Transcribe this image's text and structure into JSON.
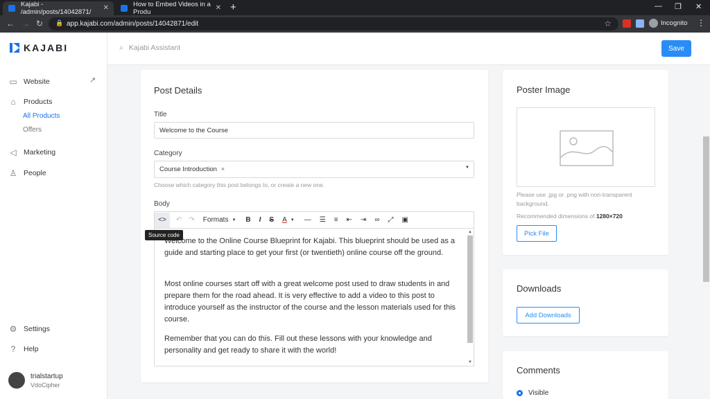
{
  "browser": {
    "tabs": [
      {
        "title": "Kajabi - /admin/posts/14042871/"
      },
      {
        "title": "How to Embed Videos in a Produ"
      }
    ],
    "url": "app.kajabi.com/admin/posts/14042871/edit",
    "profile": "Incognito"
  },
  "app": {
    "logo": "KAJABI",
    "search_placeholder": "Kajabi Assistant",
    "save_label": "Save"
  },
  "sidebar": {
    "website": "Website",
    "products": "Products",
    "all_products": "All Products",
    "offers": "Offers",
    "marketing": "Marketing",
    "people": "People",
    "settings": "Settings",
    "help": "Help",
    "user_name": "trialstartup",
    "user_org": "VdoCipher"
  },
  "post": {
    "heading": "Post Details",
    "title_label": "Title",
    "title_value": "Welcome to the Course",
    "category_label": "Category",
    "category_value": "Course Introduction",
    "category_hint": "Choose which category this post belongs to, or create a new one.",
    "body_label": "Body",
    "formats_label": "Formats",
    "tooltip": "Source code",
    "paragraphs": [
      "Welcome to the Online Course Blueprint for Kajabi. This blueprint should be used as a guide and starting place to get your first (or twentieth) online course off the ground.",
      "Most online courses start off with a great welcome post used to draw students in and prepare them for the road ahead. It is very effective to add a video to this post to introduce yourself as the instructor of the course and the lesson materials used for this course.",
      "Remember that you can do this. Fill out these lessons with your knowledge and personality and get ready to share it with the world!"
    ]
  },
  "poster": {
    "heading": "Poster Image",
    "hint": "Please use .jpg or .png with non-transparent background.",
    "dims_prefix": "Recommended dimensions of",
    "dims": "1280×720",
    "pick_label": "Pick File"
  },
  "downloads": {
    "heading": "Downloads",
    "add_label": "Add Downloads"
  },
  "comments": {
    "heading": "Comments",
    "visible_label": "Visible"
  }
}
